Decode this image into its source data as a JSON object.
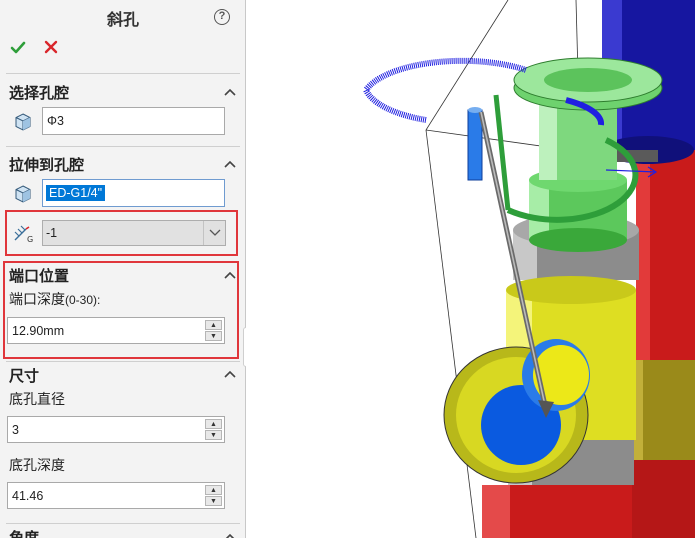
{
  "panel": {
    "title": "斜孔",
    "help_symbol": "?",
    "ok_symbol": "✔",
    "cancel_symbol": "✕",
    "sections": {
      "select_cavity": {
        "title": "选择孔腔",
        "value": "Φ3"
      },
      "extrude_to_cavity": {
        "title": "拉伸到孔腔",
        "value": "ED-G1/4\"",
        "dropdown_value": "-1",
        "dropdown_icon_label": "G"
      },
      "port_position": {
        "title": "端口位置",
        "depth_label": "端口深度",
        "depth_range": "(0-30):",
        "depth_value": "12.90mm"
      },
      "dimensions": {
        "title": "尺寸",
        "bottom_hole_diameter_label": "底孔直径",
        "bottom_hole_diameter_value": "3",
        "bottom_hole_depth_label": "底孔深度",
        "bottom_hole_depth_value": "41.46"
      },
      "angle": {
        "title": "角度"
      }
    }
  },
  "colors": {
    "accent_red_box": "#e0363b",
    "ok_green": "#2e9e3a",
    "cancel_red": "#d9262b",
    "selection_blue": "#0078d7"
  },
  "icons": {
    "ok": "checkmark-icon",
    "cancel": "close-icon",
    "help": "help-icon",
    "cube": "cube-icon",
    "axis_tool": "axis-tool-icon",
    "chevron": "chevron-up-icon",
    "spinner": "spin-arrows-icon"
  }
}
